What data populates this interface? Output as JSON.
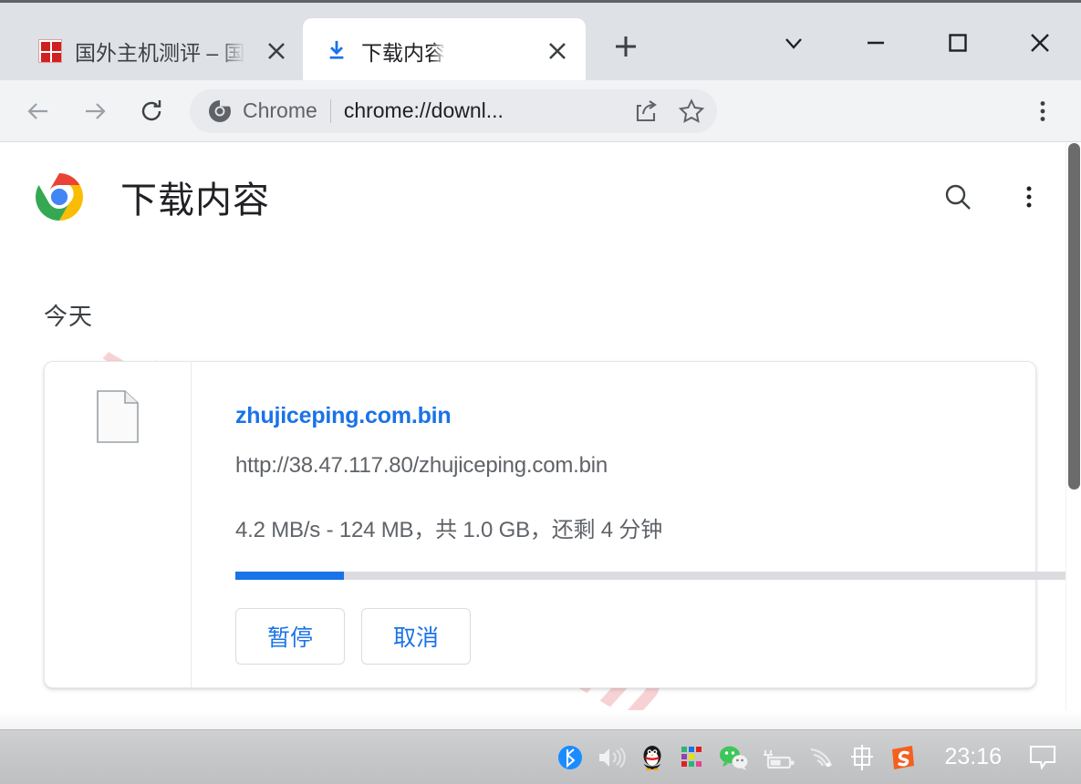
{
  "window": {
    "controls": [
      {
        "name": "tab-search-button",
        "glyph": "chevron-down-icon"
      },
      {
        "name": "minimize-button",
        "glyph": "minimize-icon"
      },
      {
        "name": "maximize-button",
        "glyph": "maximize-icon"
      },
      {
        "name": "close-button",
        "glyph": "close-icon"
      }
    ]
  },
  "tabs": [
    {
      "title": "国外主机测评 – 国",
      "favicon": "red-seal-favicon",
      "active": false,
      "close_label": "×"
    },
    {
      "title": "下载内容",
      "favicon": "download-arrow-icon",
      "active": true,
      "close_label": "×"
    }
  ],
  "new_tab_label": "+",
  "toolbar": {
    "back_icon": "arrow-left-icon",
    "forward_icon": "arrow-right-icon",
    "reload_icon": "reload-icon",
    "omnibox": {
      "chrome_icon": "chrome-mono-icon",
      "scheme_label": "Chrome",
      "url": "chrome://downl...",
      "share_icon": "share-icon",
      "bookmark_icon": "star-icon"
    },
    "menu_icon": "three-dot-menu-icon"
  },
  "downloads_page": {
    "brand_icon": "chrome-color-icon",
    "title": "下载内容",
    "search_icon": "search-icon",
    "menu_icon": "three-dot-menu-icon",
    "watermark": "zhujiceping.com",
    "section_label": "今天",
    "item": {
      "file_icon": "document-file-icon",
      "file_name": "zhujiceping.com.bin",
      "file_url": "http://38.47.117.80/zhujiceping.com.bin",
      "status": "4.2 MB/s - 124 MB，共 1.0 GB，还剩 4 分钟",
      "speed": "4.2 MB/s",
      "downloaded": "124 MB",
      "total_size": "1.0 GB",
      "time_remaining": "还剩 4 分钟",
      "progress_percent": 12,
      "progress_color": "#1a73e8",
      "pause_label": "暂停",
      "cancel_label": "取消"
    }
  },
  "taskbar": {
    "items": [
      {
        "name": "tray-bluetooth-icon",
        "label": ""
      },
      {
        "name": "tray-volume-icon",
        "label": ""
      },
      {
        "name": "tray-qq-icon",
        "label": ""
      },
      {
        "name": "tray-colorapp-icon",
        "label": ""
      },
      {
        "name": "tray-wechat-icon",
        "label": ""
      },
      {
        "name": "tray-battery-icon",
        "label": ""
      },
      {
        "name": "tray-wifi-icon",
        "label": ""
      },
      {
        "name": "tray-ime-icon",
        "label": "中"
      },
      {
        "name": "tray-sogou-icon",
        "label": "S"
      }
    ],
    "clock": "23:16",
    "notification_icon": "notification-bubble-icon"
  },
  "colors": {
    "accent_blue": "#1a73e8",
    "tabstrip_bg": "#dee1e6",
    "toolbar_bg": "#f1f3f4",
    "taskbar_bg": "#c6c7c9",
    "watermark_pink": "#f7d2d4"
  }
}
